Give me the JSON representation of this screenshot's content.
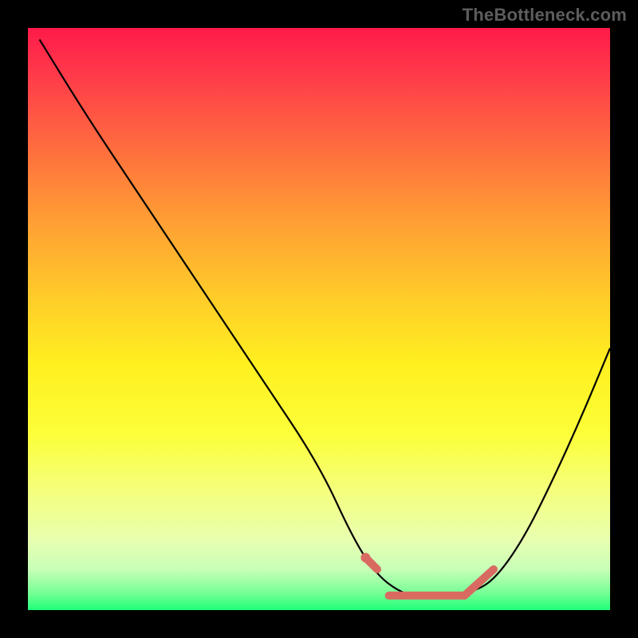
{
  "watermark": "TheBottleneck.com",
  "chart_data": {
    "type": "line",
    "title": "",
    "xlabel": "",
    "ylabel": "",
    "xlim": [
      0,
      100
    ],
    "ylim": [
      0,
      100
    ],
    "series": [
      {
        "name": "bottleneck-curve",
        "x": [
          2,
          10,
          20,
          30,
          40,
          50,
          56,
          60,
          64,
          68,
          72,
          76,
          80,
          85,
          90,
          95,
          100
        ],
        "y": [
          98,
          85,
          70,
          55,
          40,
          25,
          12,
          6,
          3,
          2,
          2,
          3,
          5,
          12,
          22,
          33,
          45
        ]
      }
    ],
    "highlight": {
      "name": "optimal-range",
      "color": "#d96a62",
      "segments": [
        {
          "x": [
            58,
            60
          ],
          "y": [
            9,
            7
          ]
        },
        {
          "x": [
            62,
            75
          ],
          "y": [
            2.5,
            2.5
          ]
        },
        {
          "x": [
            75,
            80
          ],
          "y": [
            2.5,
            7
          ]
        }
      ]
    },
    "background_gradient": [
      "#ff1a4a",
      "#ffc82a",
      "#fcff3a",
      "#20ff78"
    ]
  }
}
